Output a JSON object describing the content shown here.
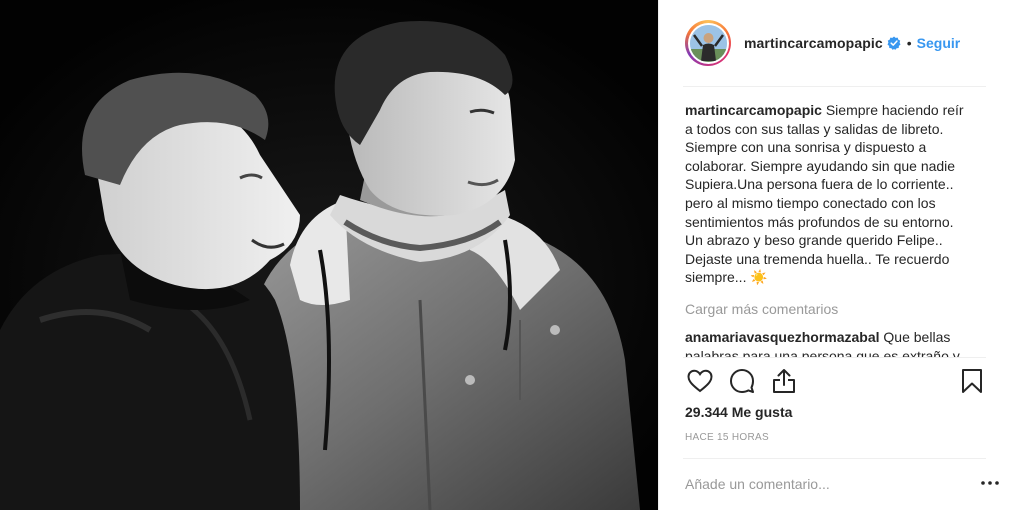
{
  "post": {
    "photo_alt": "Foto",
    "username": "martincarcamopapic",
    "follow_label": "Seguir",
    "dot": "•",
    "caption_user": "martincarcamopapic",
    "caption_lines": [
      "Siempre haciendo reír",
      "a todos con sus tallas y salidas de libreto.",
      "Siempre con una sonrisa y dispuesto a",
      "colaborar. Siempre ayudando sin que nadie",
      "Supiera.Una persona fuera de lo corriente..",
      "pero al mismo tiempo conectado con los",
      "sentimientos más profundos de su entorno.",
      "Un abrazo y beso grande querido Felipe..",
      "Dejaste una tremenda huella.. Te recuerdo",
      "siempre... ☀️"
    ],
    "load_more_label": "Cargar más comentarios",
    "comment": {
      "user": "anamariavasquezhormazabal",
      "text": "Que bellas palabras para una persona que es extraño y"
    },
    "likes": "29.344 Me gusta",
    "time": "HACE 15 HORAS",
    "add_comment_placeholder": "Añade un comentario...",
    "colors": {
      "link_blue": "#3897f0",
      "muted": "#999999",
      "text": "#262626",
      "divider": "#efefef"
    }
  }
}
